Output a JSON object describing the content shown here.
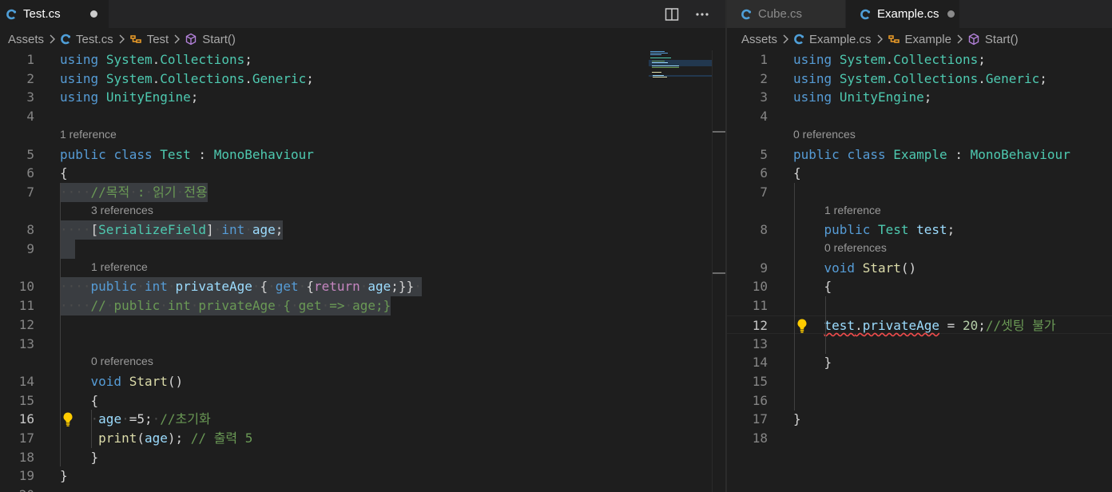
{
  "left": {
    "tabs": [
      {
        "label": "Test.cs",
        "modified": true
      }
    ],
    "breadcrumb": [
      "Assets",
      "Test.cs",
      "Test",
      "Start()"
    ],
    "lines": [
      {
        "n": "1",
        "tokens": [
          [
            "k",
            "using"
          ],
          [
            "p",
            " "
          ],
          [
            "t",
            "System"
          ],
          [
            "p",
            "."
          ],
          [
            "t",
            "Collections"
          ],
          [
            "p",
            ";"
          ]
        ]
      },
      {
        "n": "2",
        "tokens": [
          [
            "k",
            "using"
          ],
          [
            "p",
            " "
          ],
          [
            "t",
            "System"
          ],
          [
            "p",
            "."
          ],
          [
            "t",
            "Collections"
          ],
          [
            "p",
            "."
          ],
          [
            "t",
            "Generic"
          ],
          [
            "p",
            ";"
          ]
        ]
      },
      {
        "n": "3",
        "tokens": [
          [
            "k",
            "using"
          ],
          [
            "p",
            " "
          ],
          [
            "t",
            "UnityEngine"
          ],
          [
            "p",
            ";"
          ]
        ]
      },
      {
        "n": "4",
        "tokens": []
      },
      {
        "n": "5",
        "lens": "1 reference",
        "tokens": [
          [
            "k",
            "public"
          ],
          [
            "p",
            " "
          ],
          [
            "k",
            "class"
          ],
          [
            "p",
            " "
          ],
          [
            "t",
            "Test"
          ],
          [
            "p",
            " : "
          ],
          [
            "t",
            "MonoBehaviour"
          ]
        ]
      },
      {
        "n": "6",
        "tokens": [
          [
            "p",
            "{"
          ]
        ]
      },
      {
        "n": "7",
        "sel": true,
        "tokens": [
          [
            "ws",
            "····"
          ],
          [
            "c",
            "//목적"
          ],
          [
            "ws",
            "·"
          ],
          [
            "c",
            ":"
          ],
          [
            "ws",
            "·"
          ],
          [
            "c",
            "읽기"
          ],
          [
            "ws",
            "·"
          ],
          [
            "c",
            "전용"
          ]
        ]
      },
      {
        "n": "8",
        "lens": "3 references",
        "lensIndent": true,
        "sel": true,
        "tokens": [
          [
            "ws",
            "····"
          ],
          [
            "p",
            "["
          ],
          [
            "t",
            "SerializeField"
          ],
          [
            "p",
            "]"
          ],
          [
            "ws",
            "·"
          ],
          [
            "k",
            "int"
          ],
          [
            "ws",
            "·"
          ],
          [
            "v",
            "age"
          ],
          [
            "p",
            ";"
          ]
        ]
      },
      {
        "n": "9",
        "sel": true,
        "tokens": [
          [
            "ws",
            "  "
          ]
        ]
      },
      {
        "n": "10",
        "lens": "1 reference",
        "lensIndent": true,
        "sel": true,
        "tokens": [
          [
            "ws",
            "····"
          ],
          [
            "k",
            "public"
          ],
          [
            "ws",
            "·"
          ],
          [
            "k",
            "int"
          ],
          [
            "ws",
            "·"
          ],
          [
            "v",
            "privateAge"
          ],
          [
            "ws",
            "·"
          ],
          [
            "p",
            "{"
          ],
          [
            "ws",
            "·"
          ],
          [
            "k",
            "get"
          ],
          [
            "ws",
            "·"
          ],
          [
            "p",
            "{"
          ],
          [
            "kc",
            "return"
          ],
          [
            "ws",
            "·"
          ],
          [
            "v",
            "age"
          ],
          [
            "p",
            ";}}"
          ],
          [
            "ws",
            "·"
          ]
        ]
      },
      {
        "n": "11",
        "sel": true,
        "tokens": [
          [
            "ws",
            "····"
          ],
          [
            "c",
            "//"
          ],
          [
            "ws",
            "·"
          ],
          [
            "c",
            "public"
          ],
          [
            "ws",
            "·"
          ],
          [
            "c",
            "int"
          ],
          [
            "ws",
            "·"
          ],
          [
            "c",
            "privateAge"
          ],
          [
            "ws",
            "·"
          ],
          [
            "c",
            "{"
          ],
          [
            "ws",
            "·"
          ],
          [
            "c",
            "get"
          ],
          [
            "ws",
            "·"
          ],
          [
            "c",
            "=>"
          ],
          [
            "ws",
            "·"
          ],
          [
            "c",
            "age;}"
          ]
        ]
      },
      {
        "n": "12",
        "tokens": []
      },
      {
        "n": "13",
        "tokens": []
      },
      {
        "n": "14",
        "lens": "0 references",
        "lensIndent": true,
        "tokens": [
          [
            "p",
            "    "
          ],
          [
            "k",
            "void"
          ],
          [
            "p",
            " "
          ],
          [
            "f",
            "Start"
          ],
          [
            "p",
            "()"
          ]
        ]
      },
      {
        "n": "15",
        "tokens": [
          [
            "p",
            "    {"
          ]
        ]
      },
      {
        "n": "16",
        "current": true,
        "bulb": true,
        "tokens": [
          [
            "p",
            "    "
          ],
          [
            "ws",
            "·"
          ],
          [
            "v",
            "age"
          ],
          [
            "ws",
            "·"
          ],
          [
            "p",
            "=5;"
          ],
          [
            "ws",
            "·"
          ],
          [
            "c",
            "//초기화"
          ]
        ]
      },
      {
        "n": "17",
        "tokens": [
          [
            "p",
            "     "
          ],
          [
            "f",
            "print"
          ],
          [
            "p",
            "("
          ],
          [
            "v",
            "age"
          ],
          [
            "p",
            "); "
          ],
          [
            "c",
            "// 출력 5"
          ]
        ]
      },
      {
        "n": "18",
        "tokens": [
          [
            "p",
            "    }"
          ]
        ]
      },
      {
        "n": "19",
        "tokens": [
          [
            "p",
            "}"
          ]
        ]
      },
      {
        "n": "20",
        "tokens": []
      }
    ]
  },
  "right": {
    "tabs": [
      {
        "label": "Cube.cs",
        "modified": false
      },
      {
        "label": "Example.cs",
        "modified": true
      }
    ],
    "breadcrumb": [
      "Assets",
      "Example.cs",
      "Example",
      "Start()"
    ],
    "lines": [
      {
        "n": "1",
        "tokens": [
          [
            "k",
            "using"
          ],
          [
            "p",
            " "
          ],
          [
            "t",
            "System"
          ],
          [
            "p",
            "."
          ],
          [
            "t",
            "Collections"
          ],
          [
            "p",
            ";"
          ]
        ]
      },
      {
        "n": "2",
        "tokens": [
          [
            "k",
            "using"
          ],
          [
            "p",
            " "
          ],
          [
            "t",
            "System"
          ],
          [
            "p",
            "."
          ],
          [
            "t",
            "Collections"
          ],
          [
            "p",
            "."
          ],
          [
            "t",
            "Generic"
          ],
          [
            "p",
            ";"
          ]
        ]
      },
      {
        "n": "3",
        "tokens": [
          [
            "k",
            "using"
          ],
          [
            "p",
            " "
          ],
          [
            "t",
            "UnityEngine"
          ],
          [
            "p",
            ";"
          ]
        ]
      },
      {
        "n": "4",
        "tokens": []
      },
      {
        "n": "5",
        "lens": "0 references",
        "tokens": [
          [
            "k",
            "public"
          ],
          [
            "p",
            " "
          ],
          [
            "k",
            "class"
          ],
          [
            "p",
            " "
          ],
          [
            "t",
            "Example"
          ],
          [
            "p",
            " : "
          ],
          [
            "t",
            "MonoBehaviour"
          ]
        ]
      },
      {
        "n": "6",
        "tokens": [
          [
            "p",
            "{"
          ]
        ]
      },
      {
        "n": "7",
        "tokens": []
      },
      {
        "n": "8",
        "lens": "1 reference",
        "lensIndent": true,
        "tokens": [
          [
            "p",
            "    "
          ],
          [
            "k",
            "public"
          ],
          [
            "p",
            " "
          ],
          [
            "t",
            "Test"
          ],
          [
            "p",
            " "
          ],
          [
            "v",
            "test"
          ],
          [
            "p",
            ";"
          ]
        ]
      },
      {
        "n": "9",
        "lens": "0 references",
        "lensIndent": true,
        "tokens": [
          [
            "p",
            "    "
          ],
          [
            "k",
            "void"
          ],
          [
            "p",
            " "
          ],
          [
            "f",
            "Start"
          ],
          [
            "p",
            "()"
          ]
        ]
      },
      {
        "n": "10",
        "tokens": [
          [
            "p",
            "    {"
          ]
        ]
      },
      {
        "n": "11",
        "tokens": []
      },
      {
        "n": "12",
        "current": true,
        "bulb": true,
        "tokens": [
          [
            "p",
            "    "
          ],
          [
            "vs",
            "test"
          ],
          [
            "ps",
            "."
          ],
          [
            "vs",
            "privateAge"
          ],
          [
            "p",
            " = "
          ],
          [
            "n",
            "20"
          ],
          [
            "p",
            ";"
          ],
          [
            "c",
            "//셋팅 불가"
          ]
        ]
      },
      {
        "n": "13",
        "tokens": []
      },
      {
        "n": "14",
        "tokens": [
          [
            "p",
            "    }"
          ]
        ]
      },
      {
        "n": "15",
        "tokens": []
      },
      {
        "n": "16",
        "tokens": []
      },
      {
        "n": "17",
        "tokens": [
          [
            "p",
            "}"
          ]
        ]
      },
      {
        "n": "18",
        "tokens": []
      }
    ]
  },
  "colors": {
    "editor_bg": "#1e1e1e",
    "keyword": "#569cd6",
    "type": "#4ec9b0",
    "comment": "#6a9955",
    "variable": "#9cdcfe",
    "function": "#dcdcaa",
    "number": "#b5cea8",
    "control": "#c586c0",
    "csharp_icon": "#4f9fd8",
    "bulb": "#ffcc00"
  },
  "icons": {
    "file": "csharp-file-icon",
    "class": "class-symbol-icon",
    "method": "method-symbol-icon",
    "split": "split-editor-icon",
    "more": "more-actions-icon",
    "bulb": "lightbulb-icon"
  }
}
